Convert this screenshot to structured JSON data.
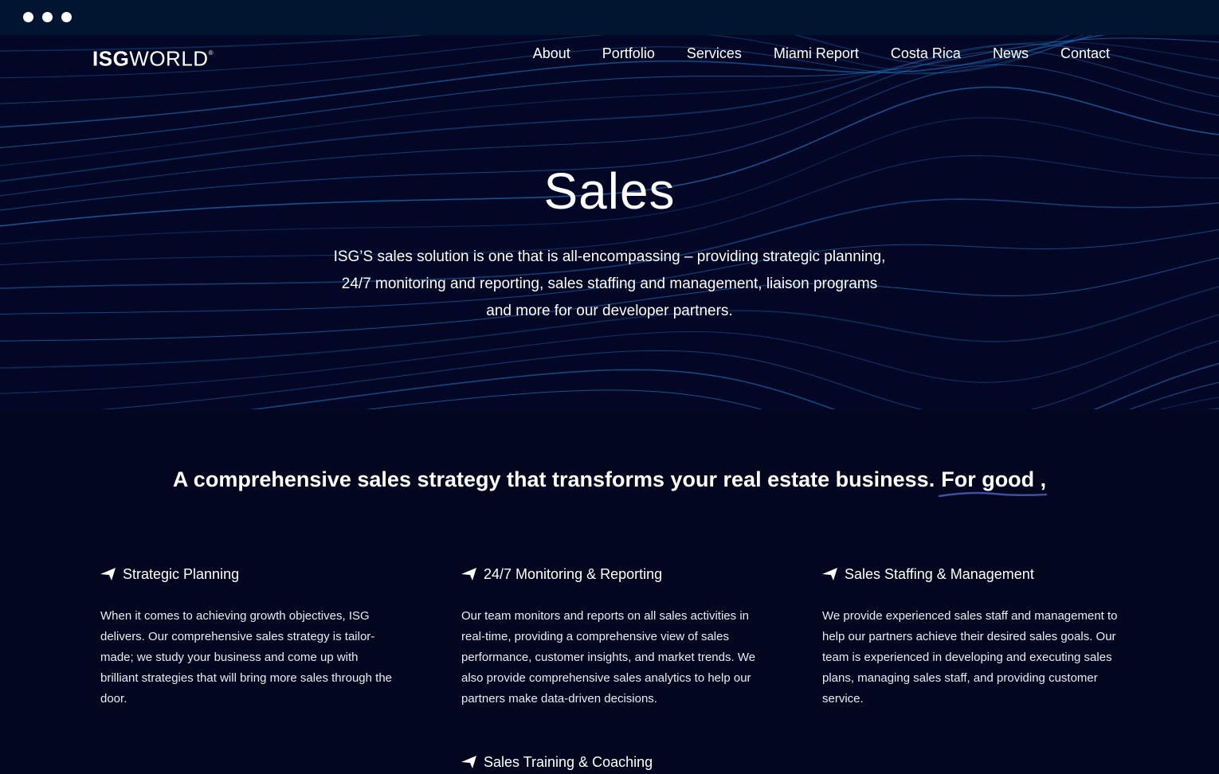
{
  "brand": {
    "logo_bold": "ISG",
    "logo_light": "WORLD",
    "logo_mark": "®"
  },
  "nav": {
    "items": [
      "About",
      "Portfolio",
      "Services",
      "Miami Report",
      "Costa Rica",
      "News",
      "Contact"
    ]
  },
  "hero": {
    "title": "Sales",
    "text": "ISG’S sales solution is one that is all-encompassing – providing strategic planning, 24/7 monitoring and reporting, sales staffing and management, liaison programs and more for our developer partners."
  },
  "tagline": {
    "text": "A comprehensive sales strategy that transforms your real estate business.",
    "accent": "For good ,"
  },
  "features": [
    {
      "title": "Strategic Planning",
      "desc": "When it comes to achieving growth objectives, ISG delivers. Our comprehensive sales strategy is tailor-made; we study your business and come up with brilliant strategies that will bring more sales through the door."
    },
    {
      "title": "24/7 Monitoring & Reporting",
      "desc": "Our team monitors and reports on all sales activities in real-time, providing a comprehensive view of sales performance, customer insights, and market trends. We also provide comprehensive sales analytics to help our partners make data-driven decisions."
    },
    {
      "title": "Sales Staffing & Management",
      "desc": "We provide experienced sales staff and management to help our partners achieve their desired sales goals. Our team is experienced in developing and executing sales plans, managing sales staff, and providing customer service."
    },
    {
      "title": "Sales Training & Coaching",
      "desc": ""
    }
  ],
  "colors": {
    "background": "#02061e",
    "hero_background": "#030726",
    "browser_bar": "#021530",
    "wave_line": "#1f6fb8",
    "accent_underline": "#3d4fa3"
  },
  "icons": {
    "feature": "arrow-pointer-icon"
  }
}
